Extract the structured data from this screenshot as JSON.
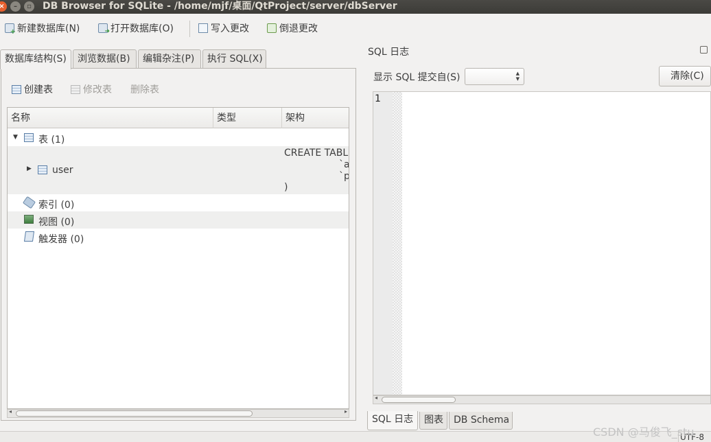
{
  "window": {
    "title": "DB Browser for SQLite - /home/mjf/桌面/QtProject/server/dbServer",
    "controls": {
      "close": "×",
      "minimize": "–",
      "maximize": "▫"
    }
  },
  "toolbar": {
    "new_db": "新建数据库(N)",
    "open_db": "打开数据库(O)",
    "write_changes": "写入更改",
    "revert_changes": "倒退更改"
  },
  "left_tabs": [
    "数据库结构(S)",
    "浏览数据(B)",
    "编辑杂注(P)",
    "执行 SQL(X)"
  ],
  "structure": {
    "create_table": "创建表",
    "modify_table": "修改表",
    "delete_table": "删除表",
    "columns": [
      "名称",
      "类型",
      "架构"
    ],
    "rows": {
      "tables": "表 (1)",
      "user": "user",
      "user_schema_lines": [
        "CREATE TABLE",
        "`a",
        "`p",
        ")"
      ],
      "indexes": "索引 (0)",
      "views": "视图 (0)",
      "triggers": "触发器 (0)"
    }
  },
  "sql_log": {
    "title": "SQL 日志",
    "show_label": "显示 SQL 提交自(S)",
    "source_value": "",
    "clear_button": "清除(C)",
    "line_number": "1"
  },
  "right_tabs": [
    "SQL 日志",
    "图表",
    "DB Schema"
  ],
  "status": {
    "encoding": "UTF-8"
  },
  "watermark": "CSDN @马俊飞_stu",
  "icons": [
    "new-db-icon",
    "open-db-icon",
    "write-changes-icon",
    "revert-changes-icon",
    "create-table-icon",
    "modify-table-icon",
    "delete-table-icon",
    "table-icon",
    "index-icon",
    "view-icon",
    "trigger-icon",
    "float-panel-icon"
  ]
}
